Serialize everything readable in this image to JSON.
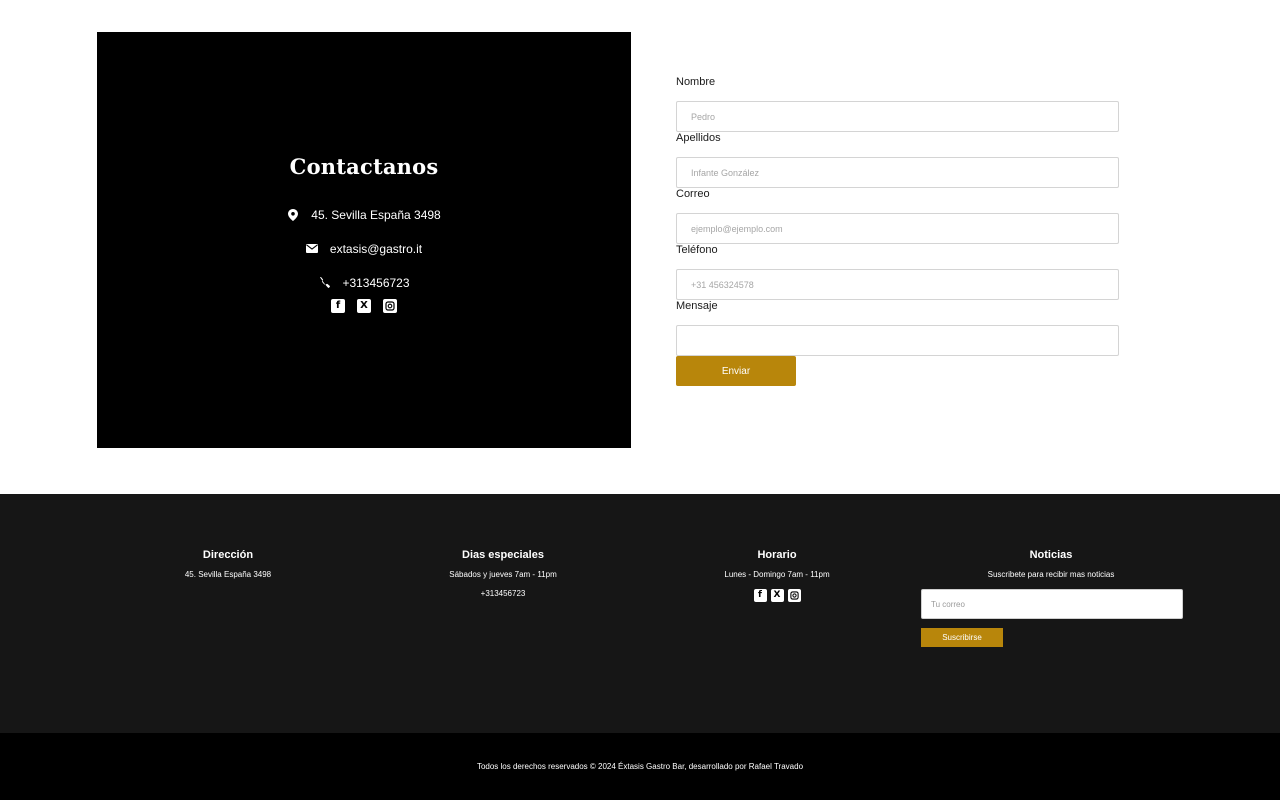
{
  "contact": {
    "title": "Contactanos",
    "address": "45. Sevilla España 3498",
    "email": "extasis@gastro.it",
    "phone": "+313456723",
    "icons": [
      "map-marker-icon",
      "envelope-icon",
      "phone-icon"
    ],
    "socials": [
      "facebook-icon",
      "x-icon",
      "instagram-icon"
    ]
  },
  "form": {
    "fields": [
      {
        "label": "Nombre",
        "placeholder": "Pedro",
        "value": ""
      },
      {
        "label": "Apellidos",
        "placeholder": "Infante González",
        "value": ""
      },
      {
        "label": "Correo",
        "placeholder": "ejemplo@ejemplo.com",
        "value": ""
      },
      {
        "label": "Teléfono",
        "placeholder": "+31 456324578",
        "value": ""
      },
      {
        "label": "Mensaje",
        "placeholder": "",
        "value": ""
      }
    ],
    "submit_label": "Enviar"
  },
  "footer": {
    "direccion": {
      "title": "Dirección",
      "line1": "45. Sevilla España 3498"
    },
    "dias": {
      "title": "Dias especiales",
      "line1": "Sábados y jueves 7am - 11pm",
      "line2": "+313456723"
    },
    "horario": {
      "title": "Horario",
      "line1": "Lunes - Domingo 7am - 11pm"
    },
    "noticias": {
      "title": "Noticias",
      "line1": "Suscribete para recibir mas noticias",
      "placeholder": "Tu correo",
      "button": "Suscribirse"
    }
  },
  "copyright": "Todos los derechos reservados © 2024 Éxtasis Gastro Bar, desarrollado por Rafael Travado",
  "colors": {
    "accent": "#b8860b",
    "card": "#000000",
    "footer": "#161616"
  }
}
